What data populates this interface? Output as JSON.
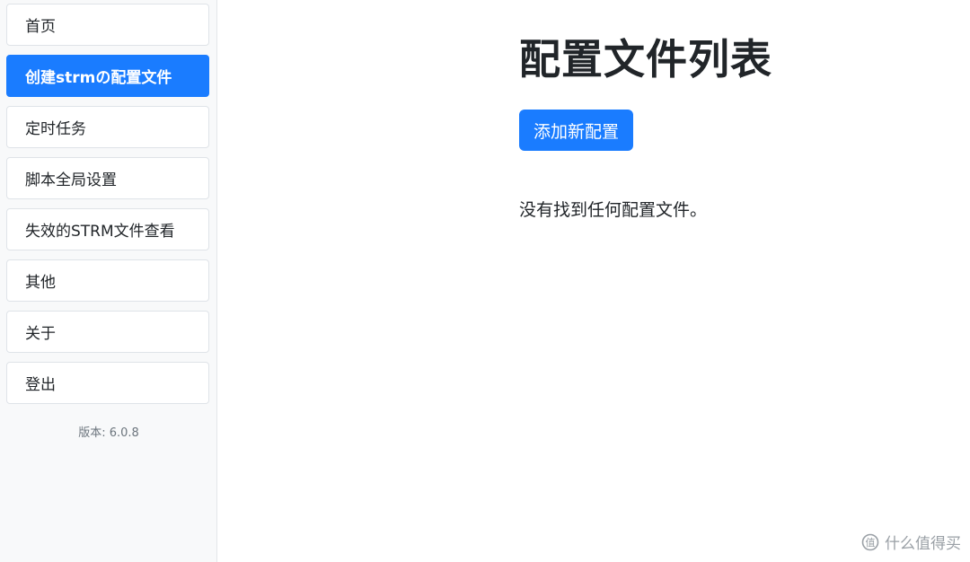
{
  "sidebar": {
    "items": [
      {
        "label": "首页",
        "active": false
      },
      {
        "label": "创建strmの配置文件",
        "active": true
      },
      {
        "label": "定时任务",
        "active": false
      },
      {
        "label": "脚本全局设置",
        "active": false
      },
      {
        "label": "失效的STRM文件查看",
        "active": false
      },
      {
        "label": "其他",
        "active": false
      },
      {
        "label": "关于",
        "active": false
      },
      {
        "label": "登出",
        "active": false
      }
    ],
    "version": "版本: 6.0.8"
  },
  "main": {
    "title": "配置文件列表",
    "add_button_label": "添加新配置",
    "empty_message": "没有找到任何配置文件。"
  },
  "watermark": {
    "text": "什么值得买"
  },
  "colors": {
    "accent": "#1a7cff",
    "sidebar_bg": "#f8f9fa",
    "text": "#212529",
    "muted": "#6c757d"
  }
}
